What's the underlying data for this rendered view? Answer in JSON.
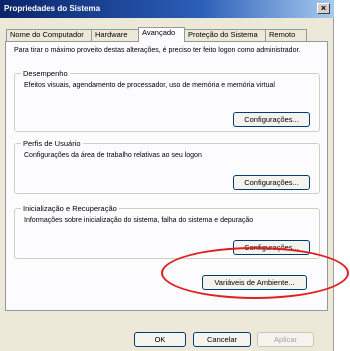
{
  "window": {
    "title": "Propriedades do Sistema",
    "close_label": "×"
  },
  "tabs": [
    {
      "label": "Nome do Computador"
    },
    {
      "label": "Hardware"
    },
    {
      "label": "Avançado",
      "active": true
    },
    {
      "label": "Proteção do Sistema"
    },
    {
      "label": "Remoto"
    }
  ],
  "panel": {
    "intro": "Para tirar o máximo proveito destas alterações, é preciso ter feito logon como administrador.",
    "groups": [
      {
        "title": "Desempenho",
        "description": "Efeitos visuais, agendamento de processador, uso de memória e memória virtual",
        "button": "Configurações..."
      },
      {
        "title": "Perfis de Usuário",
        "description": "Configurações da área de trabalho relativas ao seu logon",
        "button": "Configurações..."
      },
      {
        "title": "Inicialização e Recuperação",
        "description": "Informações sobre inicialização do sistema, falha do sistema e depuração",
        "button": "Configurações..."
      }
    ],
    "env_button": "Variáveis de Ambiente..."
  },
  "footer": {
    "ok": "OK",
    "cancel": "Cancelar",
    "apply": "Aplicar"
  },
  "colors": {
    "titlebar": "#0a246a",
    "highlight_ellipse": "#e02020",
    "dialog_bg": "#ece9d8"
  }
}
